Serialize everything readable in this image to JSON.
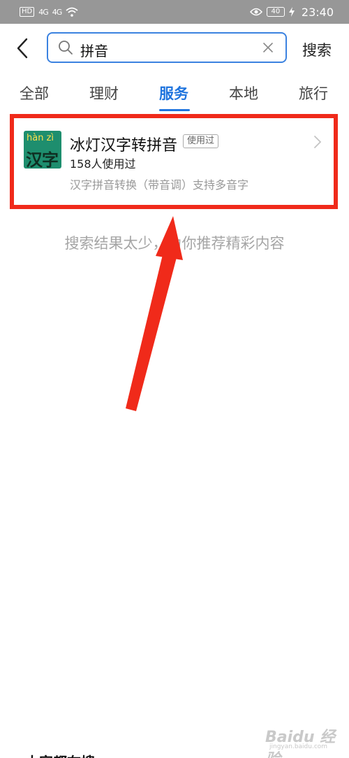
{
  "status_bar": {
    "left_badge": "HD",
    "signal_1": "4G",
    "signal_2": "4G",
    "battery": "40",
    "time": "23:40"
  },
  "search": {
    "query": "拼音",
    "submit_label": "搜索"
  },
  "tabs": [
    {
      "label": "全部",
      "active": false
    },
    {
      "label": "理财",
      "active": false
    },
    {
      "label": "服务",
      "active": true
    },
    {
      "label": "本地",
      "active": false
    },
    {
      "label": "旅行",
      "active": false
    }
  ],
  "result": {
    "icon_pinyin": "hàn zì",
    "icon_hanzi": "汉字",
    "name": "冰灯汉字转拼音",
    "badge": "使用过",
    "user_count": "158人使用过",
    "description": "汉字拼音转换（带音调）支持多音字"
  },
  "notice": "搜索结果太少，为你推荐精彩内容",
  "bottom_heading": "大家都在搜",
  "watermark": {
    "main": "Baidu 经验",
    "sub": "jingyan.baidu.com"
  },
  "colors": {
    "accent": "#1f74de",
    "highlight": "#f02a1a",
    "status_bar": "#979797"
  }
}
